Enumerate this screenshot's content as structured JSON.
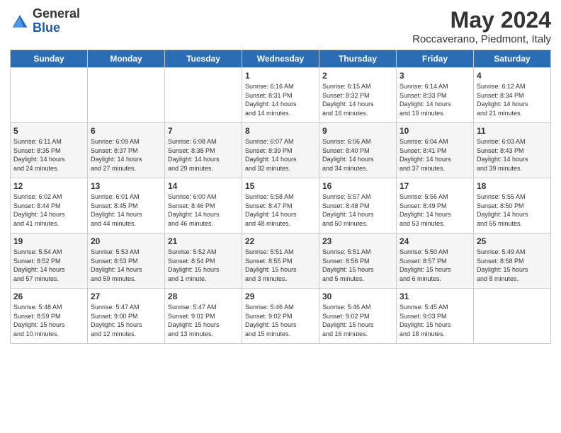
{
  "header": {
    "logo_general": "General",
    "logo_blue": "Blue",
    "title": "May 2024",
    "subtitle": "Roccaverano, Piedmont, Italy"
  },
  "calendar": {
    "days": [
      "Sunday",
      "Monday",
      "Tuesday",
      "Wednesday",
      "Thursday",
      "Friday",
      "Saturday"
    ],
    "weeks": [
      [
        {
          "day": "",
          "content": ""
        },
        {
          "day": "",
          "content": ""
        },
        {
          "day": "",
          "content": ""
        },
        {
          "day": "1",
          "content": "Sunrise: 6:16 AM\nSunset: 8:31 PM\nDaylight: 14 hours\nand 14 minutes."
        },
        {
          "day": "2",
          "content": "Sunrise: 6:15 AM\nSunset: 8:32 PM\nDaylight: 14 hours\nand 16 minutes."
        },
        {
          "day": "3",
          "content": "Sunrise: 6:14 AM\nSunset: 8:33 PM\nDaylight: 14 hours\nand 19 minutes."
        },
        {
          "day": "4",
          "content": "Sunrise: 6:12 AM\nSunset: 8:34 PM\nDaylight: 14 hours\nand 21 minutes."
        }
      ],
      [
        {
          "day": "5",
          "content": "Sunrise: 6:11 AM\nSunset: 8:35 PM\nDaylight: 14 hours\nand 24 minutes."
        },
        {
          "day": "6",
          "content": "Sunrise: 6:09 AM\nSunset: 8:37 PM\nDaylight: 14 hours\nand 27 minutes."
        },
        {
          "day": "7",
          "content": "Sunrise: 6:08 AM\nSunset: 8:38 PM\nDaylight: 14 hours\nand 29 minutes."
        },
        {
          "day": "8",
          "content": "Sunrise: 6:07 AM\nSunset: 8:39 PM\nDaylight: 14 hours\nand 32 minutes."
        },
        {
          "day": "9",
          "content": "Sunrise: 6:06 AM\nSunset: 8:40 PM\nDaylight: 14 hours\nand 34 minutes."
        },
        {
          "day": "10",
          "content": "Sunrise: 6:04 AM\nSunset: 8:41 PM\nDaylight: 14 hours\nand 37 minutes."
        },
        {
          "day": "11",
          "content": "Sunrise: 6:03 AM\nSunset: 8:43 PM\nDaylight: 14 hours\nand 39 minutes."
        }
      ],
      [
        {
          "day": "12",
          "content": "Sunrise: 6:02 AM\nSunset: 8:44 PM\nDaylight: 14 hours\nand 41 minutes."
        },
        {
          "day": "13",
          "content": "Sunrise: 6:01 AM\nSunset: 8:45 PM\nDaylight: 14 hours\nand 44 minutes."
        },
        {
          "day": "14",
          "content": "Sunrise: 6:00 AM\nSunset: 8:46 PM\nDaylight: 14 hours\nand 46 minutes."
        },
        {
          "day": "15",
          "content": "Sunrise: 5:58 AM\nSunset: 8:47 PM\nDaylight: 14 hours\nand 48 minutes."
        },
        {
          "day": "16",
          "content": "Sunrise: 5:57 AM\nSunset: 8:48 PM\nDaylight: 14 hours\nand 50 minutes."
        },
        {
          "day": "17",
          "content": "Sunrise: 5:56 AM\nSunset: 8:49 PM\nDaylight: 14 hours\nand 53 minutes."
        },
        {
          "day": "18",
          "content": "Sunrise: 5:55 AM\nSunset: 8:50 PM\nDaylight: 14 hours\nand 55 minutes."
        }
      ],
      [
        {
          "day": "19",
          "content": "Sunrise: 5:54 AM\nSunset: 8:52 PM\nDaylight: 14 hours\nand 57 minutes."
        },
        {
          "day": "20",
          "content": "Sunrise: 5:53 AM\nSunset: 8:53 PM\nDaylight: 14 hours\nand 59 minutes."
        },
        {
          "day": "21",
          "content": "Sunrise: 5:52 AM\nSunset: 8:54 PM\nDaylight: 15 hours\nand 1 minute."
        },
        {
          "day": "22",
          "content": "Sunrise: 5:51 AM\nSunset: 8:55 PM\nDaylight: 15 hours\nand 3 minutes."
        },
        {
          "day": "23",
          "content": "Sunrise: 5:51 AM\nSunset: 8:56 PM\nDaylight: 15 hours\nand 5 minutes."
        },
        {
          "day": "24",
          "content": "Sunrise: 5:50 AM\nSunset: 8:57 PM\nDaylight: 15 hours\nand 6 minutes."
        },
        {
          "day": "25",
          "content": "Sunrise: 5:49 AM\nSunset: 8:58 PM\nDaylight: 15 hours\nand 8 minutes."
        }
      ],
      [
        {
          "day": "26",
          "content": "Sunrise: 5:48 AM\nSunset: 8:59 PM\nDaylight: 15 hours\nand 10 minutes."
        },
        {
          "day": "27",
          "content": "Sunrise: 5:47 AM\nSunset: 9:00 PM\nDaylight: 15 hours\nand 12 minutes."
        },
        {
          "day": "28",
          "content": "Sunrise: 5:47 AM\nSunset: 9:01 PM\nDaylight: 15 hours\nand 13 minutes."
        },
        {
          "day": "29",
          "content": "Sunrise: 5:46 AM\nSunset: 9:02 PM\nDaylight: 15 hours\nand 15 minutes."
        },
        {
          "day": "30",
          "content": "Sunrise: 5:46 AM\nSunset: 9:02 PM\nDaylight: 15 hours\nand 16 minutes."
        },
        {
          "day": "31",
          "content": "Sunrise: 5:45 AM\nSunset: 9:03 PM\nDaylight: 15 hours\nand 18 minutes."
        },
        {
          "day": "",
          "content": ""
        }
      ]
    ]
  }
}
